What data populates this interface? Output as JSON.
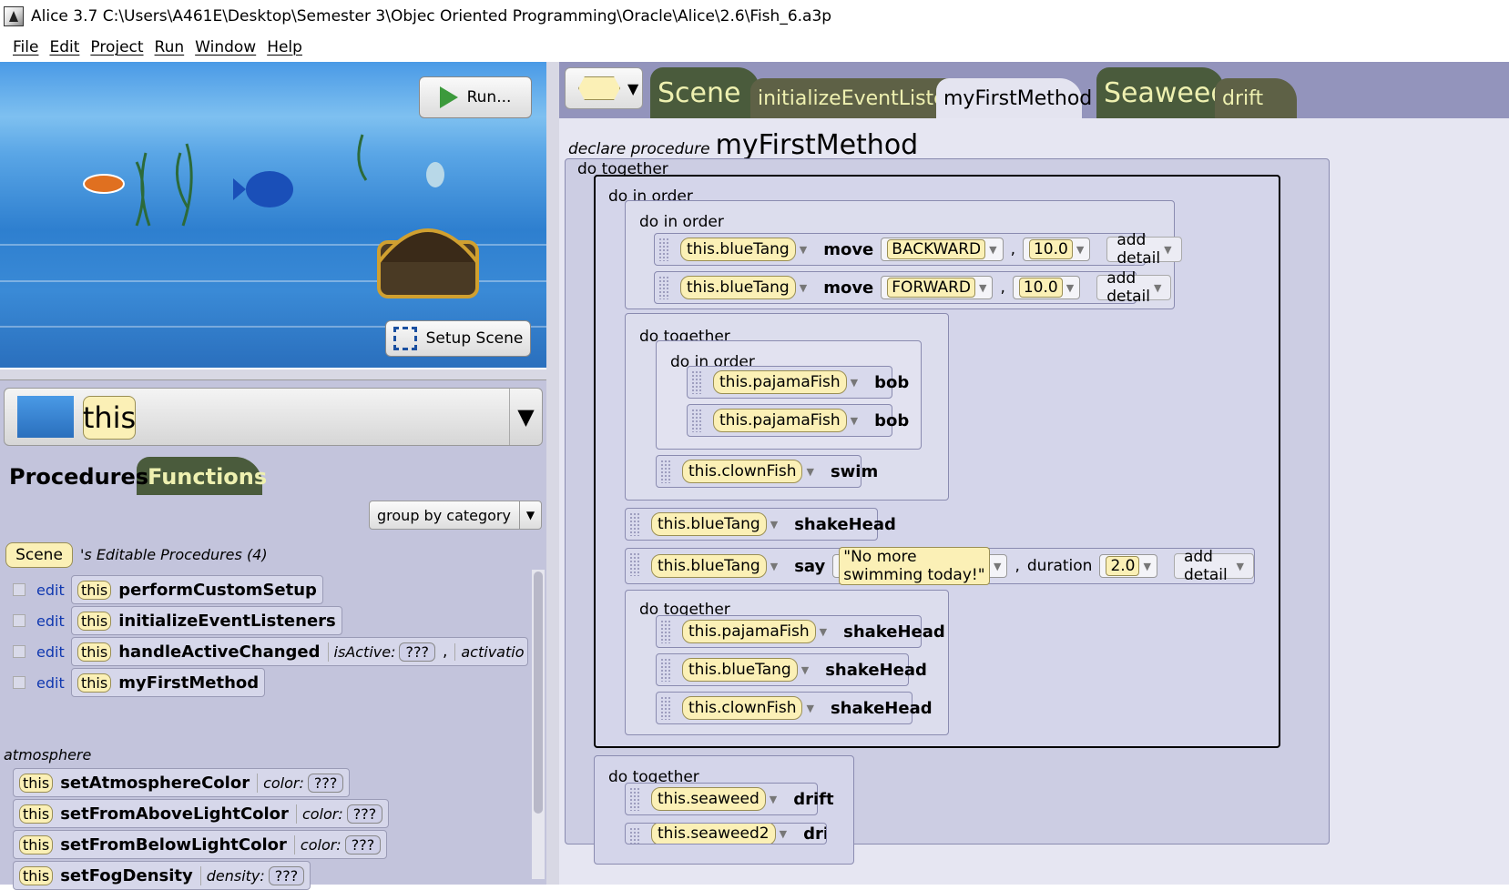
{
  "window": {
    "title": "Alice 3.7 C:\\Users\\A461E\\Desktop\\Semester 3\\Objec Oriented Programming\\Oracle\\Alice\\2.6\\Fish_6.a3p"
  },
  "menu": [
    "File",
    "Edit",
    "Project",
    "Run",
    "Window",
    "Help"
  ],
  "scene_view": {
    "run_label": "Run...",
    "setup_label": "Setup Scene"
  },
  "selector": {
    "value": "this"
  },
  "left_tabs": {
    "procedures": "Procedures",
    "functions": "Functions"
  },
  "group_by": "group by category",
  "editable": {
    "owner": "Scene",
    "heading": "'s Editable Procedures (4)"
  },
  "editable_procs": [
    {
      "edit": "edit",
      "this": "this",
      "name": "performCustomSetup"
    },
    {
      "edit": "edit",
      "this": "this",
      "name": "initializeEventListeners"
    },
    {
      "edit": "edit",
      "this": "this",
      "name": "handleActiveChanged",
      "param": "isActive:",
      "val": "???",
      "extra": "activatio"
    },
    {
      "edit": "edit",
      "this": "this",
      "name": "myFirstMethod"
    }
  ],
  "category": "atmosphere",
  "atmosphere_procs": [
    {
      "this": "this",
      "name": "setAtmosphereColor",
      "param": "color:",
      "val": "???"
    },
    {
      "this": "this",
      "name": "setFromAboveLightColor",
      "param": "color:",
      "val": "???"
    },
    {
      "this": "this",
      "name": "setFromBelowLightColor",
      "param": "color:",
      "val": "???"
    },
    {
      "this": "this",
      "name": "setFogDensity",
      "param": "density:",
      "val": "???"
    }
  ],
  "editor_tabs": {
    "scene": "Scene",
    "init": "initializeEventListeners",
    "first": "myFirstMethod",
    "seaweed": "Seaweed",
    "drift": "drift"
  },
  "code": {
    "declare": "declare procedure",
    "method": "myFirstMethod",
    "do_together": "do together",
    "do_in_order": "do in order",
    "add_detail": "add detail",
    "comma": ",",
    "s1": {
      "obj": "this.blueTang",
      "m": "move",
      "dir": "BACKWARD",
      "amt": "10.0"
    },
    "s2": {
      "obj": "this.blueTang",
      "m": "move",
      "dir": "FORWARD",
      "amt": "10.0"
    },
    "s3": {
      "obj": "this.pajamaFish",
      "m": "bob"
    },
    "s4": {
      "obj": "this.pajamaFish",
      "m": "bob"
    },
    "s5": {
      "obj": "this.clownFish",
      "m": "swim"
    },
    "s6": {
      "obj": "this.blueTang",
      "m": "shakeHead"
    },
    "s7": {
      "obj": "this.blueTang",
      "m": "say",
      "text": "\"No more swimming today!\"",
      "dur_label": "duration",
      "dur": "2.0"
    },
    "s8": {
      "obj": "this.pajamaFish",
      "m": "shakeHead"
    },
    "s9": {
      "obj": "this.blueTang",
      "m": "shakeHead"
    },
    "s10": {
      "obj": "this.clownFish",
      "m": "shakeHead"
    },
    "s11": {
      "obj": "this.seaweed",
      "m": "drift"
    },
    "s12": {
      "obj": "this.seaweed2",
      "m": "drift"
    }
  }
}
